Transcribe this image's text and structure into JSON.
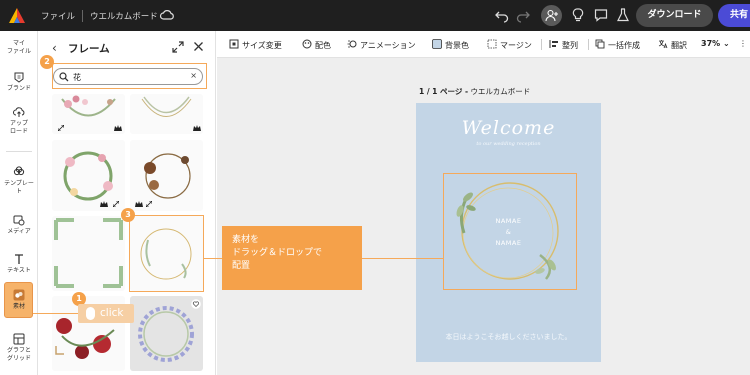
{
  "topbar": {
    "file_label": "ファイル",
    "document_title": "ウエルカムボード",
    "download_label": "ダウンロード",
    "share_label": "共有"
  },
  "rail": {
    "items": [
      {
        "label": "マイ\nファイル",
        "icon": "folder-icon"
      },
      {
        "label": "ブランド",
        "icon": "brand-icon"
      },
      {
        "label": "アップ\nロード",
        "icon": "upload-icon"
      },
      {
        "label": "テンプレー\nト",
        "icon": "template-icon"
      },
      {
        "label": "メディア",
        "icon": "media-icon"
      },
      {
        "label": "テキスト",
        "icon": "text-icon"
      },
      {
        "label": "素材",
        "icon": "elements-icon"
      },
      {
        "label": "グラフと\nグリッド",
        "icon": "grid-icon"
      }
    ]
  },
  "panel": {
    "title": "フレーム",
    "search_value": "花",
    "search_clear": "×"
  },
  "toolbar": {
    "resize": "サイズ変更",
    "color": "配色",
    "animation": "アニメーション",
    "background": "背景色",
    "margin": "マージン",
    "align": "整列",
    "bulk_create": "一括作成",
    "translate": "翻訳",
    "zoom": "37%"
  },
  "canvas": {
    "page_indicator": "1 / 1 ページ -",
    "page_name": "ウエルカムボード",
    "welcome_text": "Welcome",
    "subtitle_text": "to our wedding reception",
    "name_1": "NAMAE",
    "ampersand": "&",
    "name_2": "NAMAE",
    "footer_text": "本日はようこそお越しくださいました。"
  },
  "annotations": {
    "step1": "1",
    "step2": "2",
    "step3": "3",
    "click_label": "click",
    "callout_line1": "素材を",
    "callout_line2": "ドラッグ＆ドロップで",
    "callout_line3": "配置"
  },
  "colors": {
    "accent": "#f5a14a",
    "artboard": "#c3d5e6",
    "share": "#4b4bd6",
    "topbar": "#1f1f1f"
  }
}
